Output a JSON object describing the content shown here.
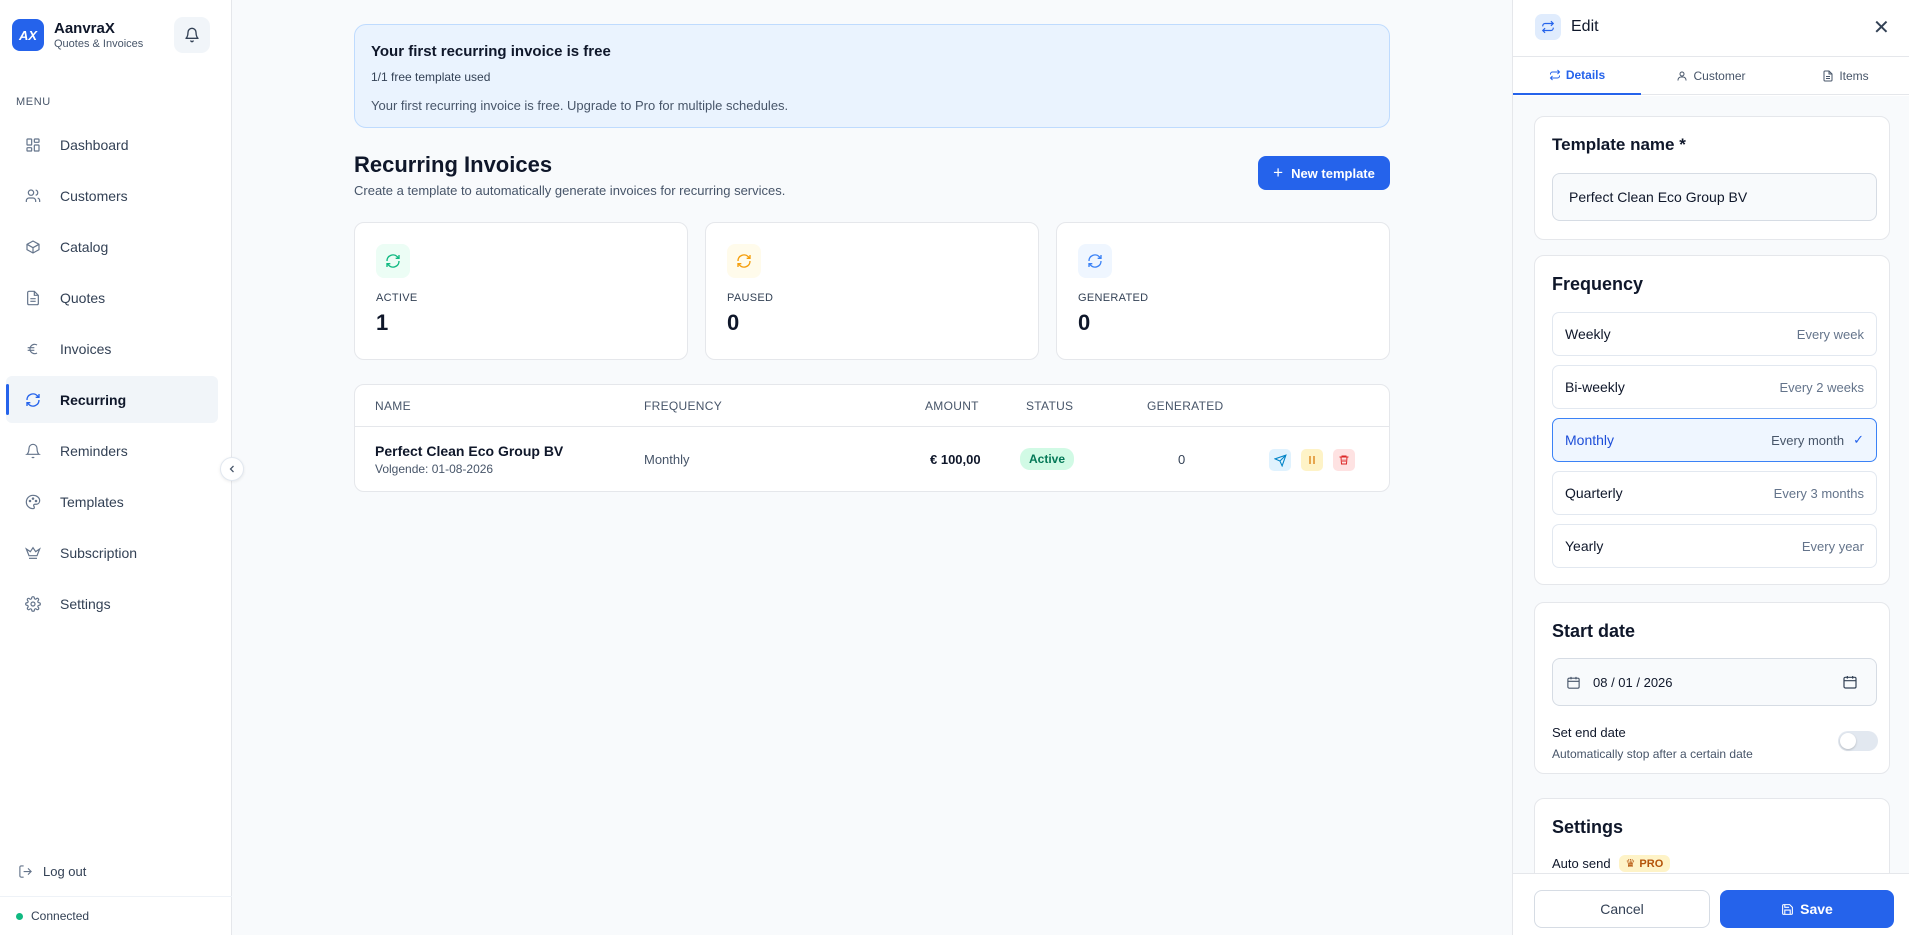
{
  "brand": {
    "logo": "AX",
    "name": "AanvraX",
    "subtitle": "Quotes & Invoices"
  },
  "sidebar": {
    "menu_label": "MENU",
    "items": [
      {
        "label": "Dashboard",
        "icon": "dashboard-icon"
      },
      {
        "label": "Customers",
        "icon": "users-icon"
      },
      {
        "label": "Catalog",
        "icon": "box-icon"
      },
      {
        "label": "Quotes",
        "icon": "document-icon"
      },
      {
        "label": "Invoices",
        "icon": "euro-icon"
      },
      {
        "label": "Recurring",
        "icon": "refresh-icon",
        "active": true
      },
      {
        "label": "Reminders",
        "icon": "bell-icon"
      },
      {
        "label": "Templates",
        "icon": "palette-icon"
      },
      {
        "label": "Subscription",
        "icon": "crown-icon"
      },
      {
        "label": "Settings",
        "icon": "gear-icon"
      }
    ],
    "logout": "Log out",
    "status": "Connected"
  },
  "banner": {
    "title": "Your first recurring invoice is free",
    "usage": "1/1 free template used",
    "description": "Your first recurring invoice is free. Upgrade to Pro for multiple schedules."
  },
  "page": {
    "title": "Recurring Invoices",
    "subtitle": "Create a template to automatically generate invoices for recurring services.",
    "new_button": "New template"
  },
  "stats": [
    {
      "label": "ACTIVE",
      "value": "1",
      "color": "#10b981"
    },
    {
      "label": "PAUSED",
      "value": "0",
      "color": "#f59e0b"
    },
    {
      "label": "GENERATED",
      "value": "0",
      "color": "#3b82f6"
    }
  ],
  "table": {
    "columns": [
      "NAME",
      "FREQUENCY",
      "AMOUNT",
      "STATUS",
      "GENERATED"
    ],
    "rows": [
      {
        "name": "Perfect Clean Eco Group BV",
        "next": "Volgende: 01-08-2026",
        "frequency": "Monthly",
        "amount": "€ 100,00",
        "status": "Active",
        "generated": "0"
      }
    ]
  },
  "panel": {
    "title": "Edit",
    "tabs": [
      "Details",
      "Customer",
      "Items"
    ],
    "template_name_label": "Template name *",
    "template_name_value": "Perfect Clean Eco Group BV",
    "frequency_label": "Frequency",
    "frequencies": [
      {
        "label": "Weekly",
        "desc": "Every week"
      },
      {
        "label": "Bi-weekly",
        "desc": "Every 2 weeks"
      },
      {
        "label": "Monthly",
        "desc": "Every month",
        "selected": true
      },
      {
        "label": "Quarterly",
        "desc": "Every 3 months"
      },
      {
        "label": "Yearly",
        "desc": "Every year"
      }
    ],
    "start_date_label": "Start date",
    "start_date_value": "08 / 01 / 2026",
    "end_date_label": "Set end date",
    "end_date_desc": "Automatically stop after a certain date",
    "end_date_enabled": false,
    "settings_label": "Settings",
    "auto_send_label": "Auto send",
    "pro_badge": "PRO",
    "cancel": "Cancel",
    "save": "Save"
  }
}
